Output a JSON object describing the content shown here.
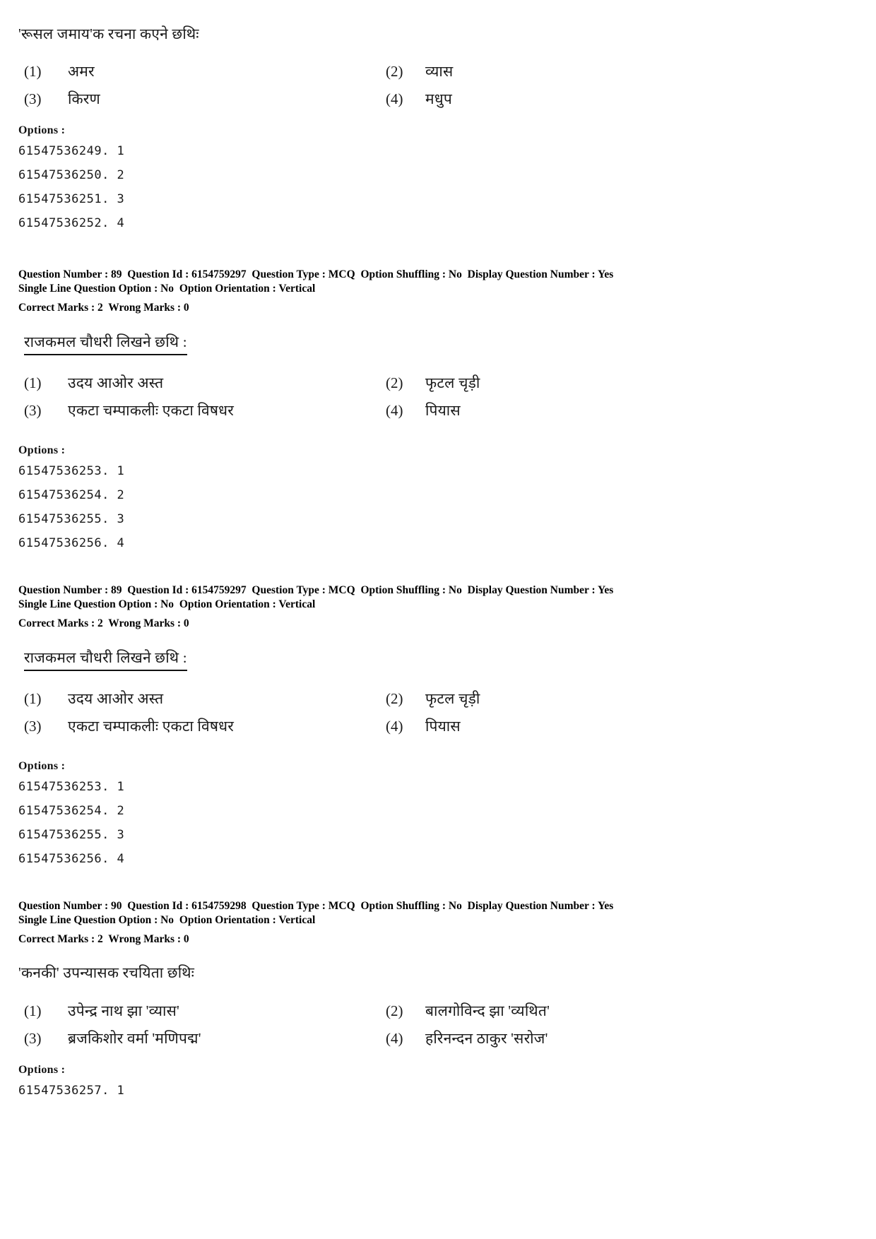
{
  "labels": {
    "options_heading": "Options :",
    "meta_question_number": "Question Number :",
    "meta_question_id": "Question Id :",
    "meta_question_type": "Question Type :",
    "meta_option_shuffling": "Option Shuffling :",
    "meta_display_question_number": "Display Question Number :",
    "meta_single_line": "Single Line Question Option :",
    "meta_option_orientation": "Option Orientation :",
    "meta_correct_marks": "Correct Marks :",
    "meta_wrong_marks": "Wrong Marks :"
  },
  "blocks": [
    {
      "id": "block-88-tail",
      "stem": "'रूसल जमाय'क रचना कएने छथिः",
      "stem_underlined": false,
      "options": [
        {
          "num": "(1)",
          "text": "अमर"
        },
        {
          "num": "(2)",
          "text": "व्यास"
        },
        {
          "num": "(3)",
          "text": "किरण"
        },
        {
          "num": "(4)",
          "text": "मधुप"
        }
      ],
      "option_ids": [
        "61547536249. 1",
        "61547536250. 2",
        "61547536251. 3",
        "61547536252. 4"
      ],
      "meta": null
    },
    {
      "id": "block-89-a",
      "meta": {
        "question_number": "89",
        "question_id": "6154759297",
        "question_type": "MCQ",
        "option_shuffling": "No",
        "display_question_number": "Yes",
        "single_line_question_option": "No",
        "option_orientation": "Vertical",
        "correct_marks": "2",
        "wrong_marks": "0"
      },
      "stem": "राजकमल चौधरी लिखने छथि :",
      "stem_underlined": true,
      "options": [
        {
          "num": "(1)",
          "text": "उदय आओर अस्त"
        },
        {
          "num": "(2)",
          "text": "फृटल चृड़ी"
        },
        {
          "num": "(3)",
          "text": "एकटा चम्पाकलीः एकटा विषधर"
        },
        {
          "num": "(4)",
          "text": "पियास"
        }
      ],
      "option_ids": [
        "61547536253. 1",
        "61547536254. 2",
        "61547536255. 3",
        "61547536256. 4"
      ]
    },
    {
      "id": "block-89-b",
      "meta": {
        "question_number": "89",
        "question_id": "6154759297",
        "question_type": "MCQ",
        "option_shuffling": "No",
        "display_question_number": "Yes",
        "single_line_question_option": "No",
        "option_orientation": "Vertical",
        "correct_marks": "2",
        "wrong_marks": "0"
      },
      "stem": "राजकमल चौधरी लिखने छथि :",
      "stem_underlined": true,
      "options": [
        {
          "num": "(1)",
          "text": "उदय आओर अस्त"
        },
        {
          "num": "(2)",
          "text": "फृटल चृड़ी"
        },
        {
          "num": "(3)",
          "text": "एकटा चम्पाकलीः एकटा विषधर"
        },
        {
          "num": "(4)",
          "text": "पियास"
        }
      ],
      "option_ids": [
        "61547536253. 1",
        "61547536254. 2",
        "61547536255. 3",
        "61547536256. 4"
      ]
    },
    {
      "id": "block-90",
      "meta": {
        "question_number": "90",
        "question_id": "6154759298",
        "question_type": "MCQ",
        "option_shuffling": "No",
        "display_question_number": "Yes",
        "single_line_question_option": "No",
        "option_orientation": "Vertical",
        "correct_marks": "2",
        "wrong_marks": "0"
      },
      "stem": "'कनकी' उपन्यासक रचयिता छथिः",
      "stem_underlined": false,
      "options": [
        {
          "num": "(1)",
          "text": "उपेन्द्र नाथ झा 'व्यास'"
        },
        {
          "num": "(2)",
          "text": "बालगोविन्द झा 'व्यथित'"
        },
        {
          "num": "(3)",
          "text": "ब्रजकिशोर वर्मा 'मणिपद्म'"
        },
        {
          "num": "(4)",
          "text": "हरिनन्दन ठाकुर 'सरोज'"
        }
      ],
      "option_ids": [
        "61547536257. 1"
      ]
    }
  ]
}
